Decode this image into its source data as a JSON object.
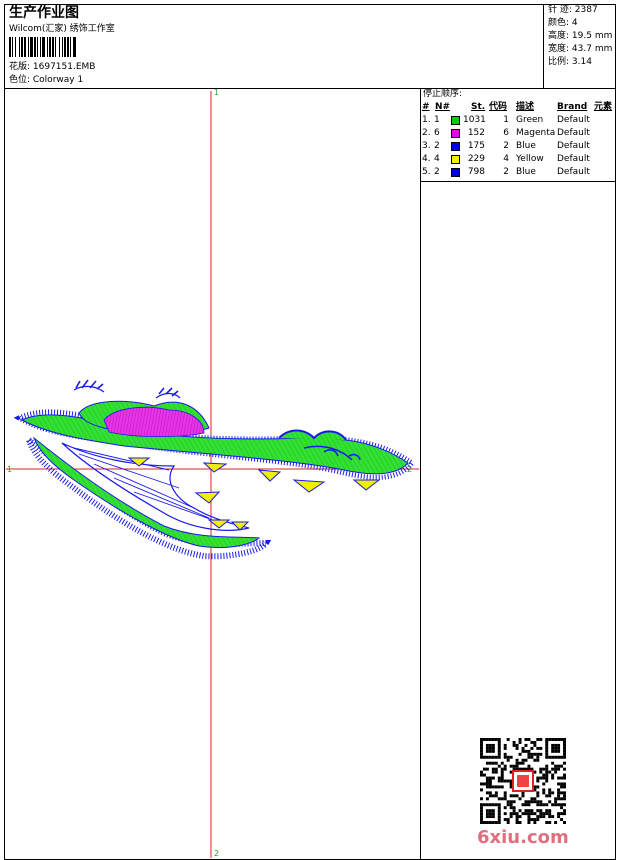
{
  "header": {
    "title": "生产作业图",
    "company": "Wilcom(汇家) 绣饰工作室",
    "pattern": "花版: 1697151.EMB",
    "colorway": "色位: Colorway 1"
  },
  "stats": [
    {
      "label": "针 迹:",
      "value": "2387"
    },
    {
      "label": "颜色:",
      "value": "4"
    },
    {
      "label": "高度:",
      "value": "19.5 mm"
    },
    {
      "label": "宽度:",
      "value": "43.7 mm"
    },
    {
      "label": "比例:",
      "value": "3.14"
    }
  ],
  "stop_sequence": {
    "title": "停止顺序:",
    "headers": [
      "#",
      "N#",
      "St.",
      "代码",
      "描述",
      "Brand",
      "元素"
    ],
    "rows": [
      {
        "num": "1.",
        "n": "1",
        "st": "1031",
        "code": "1",
        "desc": "Green",
        "brand": "Default",
        "color": "#00cc00"
      },
      {
        "num": "2.",
        "n": "6",
        "st": "152",
        "code": "6",
        "desc": "Magenta",
        "brand": "Default",
        "color": "#e800e8"
      },
      {
        "num": "3.",
        "n": "2",
        "st": "175",
        "code": "2",
        "desc": "Blue",
        "brand": "Default",
        "color": "#0000dd"
      },
      {
        "num": "4.",
        "n": "4",
        "st": "229",
        "code": "4",
        "desc": "Yellow",
        "brand": "Default",
        "color": "#f2f200"
      },
      {
        "num": "5.",
        "n": "2",
        "st": "798",
        "code": "2",
        "desc": "Blue",
        "brand": "Default",
        "color": "#0000dd"
      }
    ]
  },
  "axes": {
    "top": "1",
    "bottom": "2",
    "left": "1",
    "right": "2"
  },
  "watermark": "6xiu.com",
  "colors": {
    "green": "#22dd22",
    "blue": "#1a1aee",
    "magenta": "#dd22dd",
    "yellow": "#f0f000",
    "axis": "#dd2222"
  }
}
